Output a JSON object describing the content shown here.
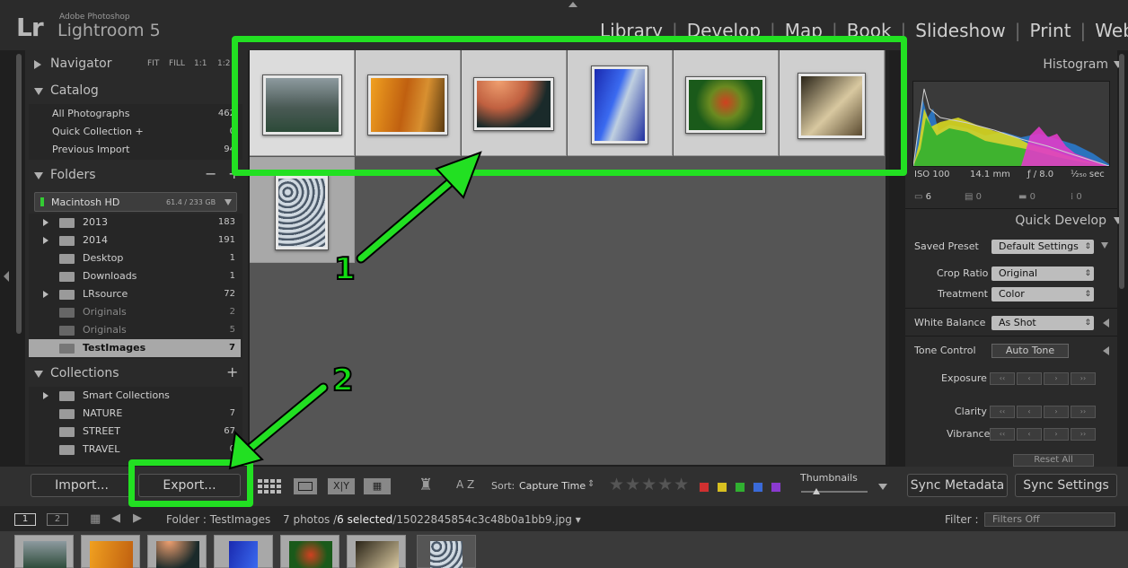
{
  "app": {
    "logo": "Lr",
    "company": "Adobe Photoshop",
    "product": "Lightroom 5",
    "modules": [
      "Library",
      "Develop",
      "Map",
      "Book",
      "Slideshow",
      "Print",
      "Web"
    ]
  },
  "navigator": {
    "title": "Navigator",
    "zoom_options": [
      "FIT",
      "FILL",
      "1:1",
      "1:2"
    ]
  },
  "catalog": {
    "title": "Catalog",
    "items": [
      {
        "label": "All Photographs",
        "count": "462"
      },
      {
        "label": "Quick Collection +",
        "count": "0"
      },
      {
        "label": "Previous Import",
        "count": "94"
      }
    ]
  },
  "folders": {
    "title": "Folders",
    "add": "+",
    "remove": "−",
    "volume": {
      "label": "Macintosh HD",
      "size": "61.4 / 233 GB"
    },
    "items": [
      {
        "label": "2013",
        "count": "183"
      },
      {
        "label": "2014",
        "count": "191"
      },
      {
        "label": "Desktop",
        "count": "1"
      },
      {
        "label": "Downloads",
        "count": "1"
      },
      {
        "label": "LRsource",
        "count": "72"
      },
      {
        "label": "Originals",
        "count": "2"
      },
      {
        "label": "Originals",
        "count": "5"
      },
      {
        "label": "TestImages",
        "count": "7"
      }
    ]
  },
  "collections": {
    "title": "Collections",
    "add": "+",
    "items": [
      {
        "label": "Smart Collections",
        "count": ""
      },
      {
        "label": "NATURE",
        "count": "7"
      },
      {
        "label": "STREET",
        "count": "67"
      },
      {
        "label": "TRAVEL",
        "count": "0"
      }
    ]
  },
  "histogram": {
    "title": "Histogram",
    "iso": "ISO 100",
    "focal": "14.1 mm",
    "aperture": "ƒ / 8.0",
    "shutter": "¹⁄₂₅₀ sec",
    "icon_counts": [
      "6",
      "0",
      "0",
      "0"
    ]
  },
  "quick_develop": {
    "title": "Quick Develop",
    "saved_preset_label": "Saved Preset",
    "saved_preset_value": "Default Settings",
    "crop_label": "Crop Ratio",
    "crop_value": "Original",
    "treatment_label": "Treatment",
    "treatment_value": "Color",
    "wb_label": "White Balance",
    "wb_value": "As Shot",
    "tone_label": "Tone Control",
    "auto_tone": "Auto Tone",
    "exposure_label": "Exposure",
    "clarity_label": "Clarity",
    "vibrance_label": "Vibrance",
    "reset_all": "Reset All",
    "step_glyphs": [
      "‹‹",
      "‹",
      "›",
      "››"
    ]
  },
  "toolbar": {
    "import": "Import...",
    "export": "Export...",
    "sort_label": "Sort:",
    "sort_value": "Capture Time",
    "stars": "★★★★★",
    "thumbnails_label": "Thumbnails",
    "sync_metadata": "Sync Metadata",
    "sync_settings": "Sync Settings",
    "view_xy": "X|Y",
    "sort_az": "A Z"
  },
  "colors": {
    "accent_annotation": "#22e022",
    "labels": [
      "#d03030",
      "#d8c020",
      "#30b030",
      "#3a6ad8",
      "#8a3ad0"
    ]
  },
  "filmbar": {
    "screen1": "1",
    "screen2": "2",
    "source": "Folder : TestImages",
    "count_prefix": "7 photos /",
    "selected": "6 selected",
    "filename": "/15022845854c3c48b0a1bb9.jpg",
    "filter_label": "Filter :",
    "filter_value": "Filters Off"
  },
  "annotations": {
    "one": "1",
    "two": "2"
  }
}
